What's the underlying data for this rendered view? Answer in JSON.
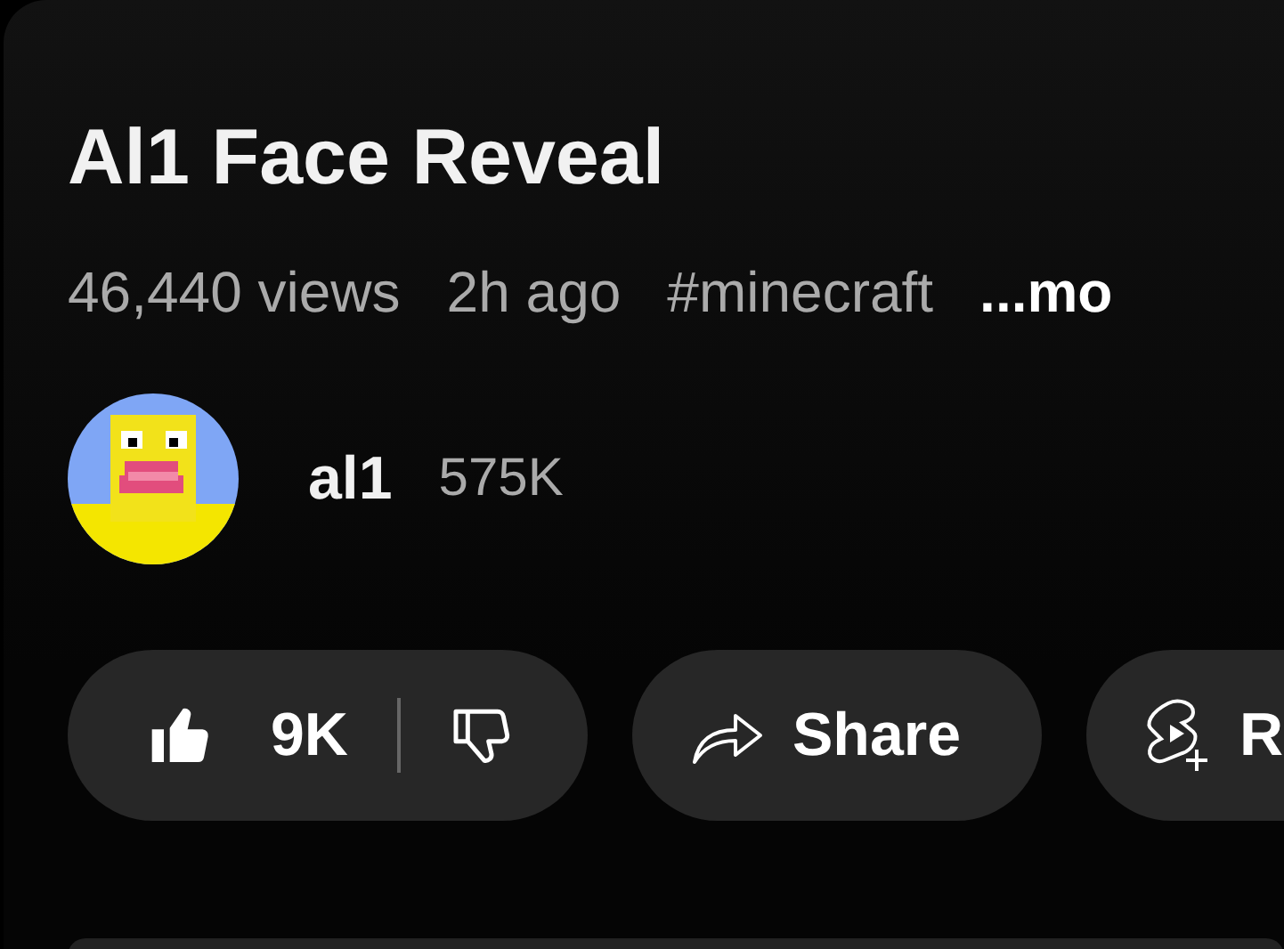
{
  "video": {
    "title": "Al1 Face Reveal",
    "meta": [
      {
        "kind": "info",
        "text": "46,440 views"
      },
      {
        "kind": "info",
        "text": "2h ago"
      },
      {
        "kind": "info",
        "text": "#minecraft"
      },
      {
        "kind": "more",
        "text": "...mo"
      }
    ]
  },
  "channel": {
    "name": "al1",
    "subscribers": "575K"
  },
  "actions": {
    "like": {
      "count": "9K",
      "liked": true,
      "disliked": false
    },
    "share": "Share",
    "remix": "R"
  }
}
